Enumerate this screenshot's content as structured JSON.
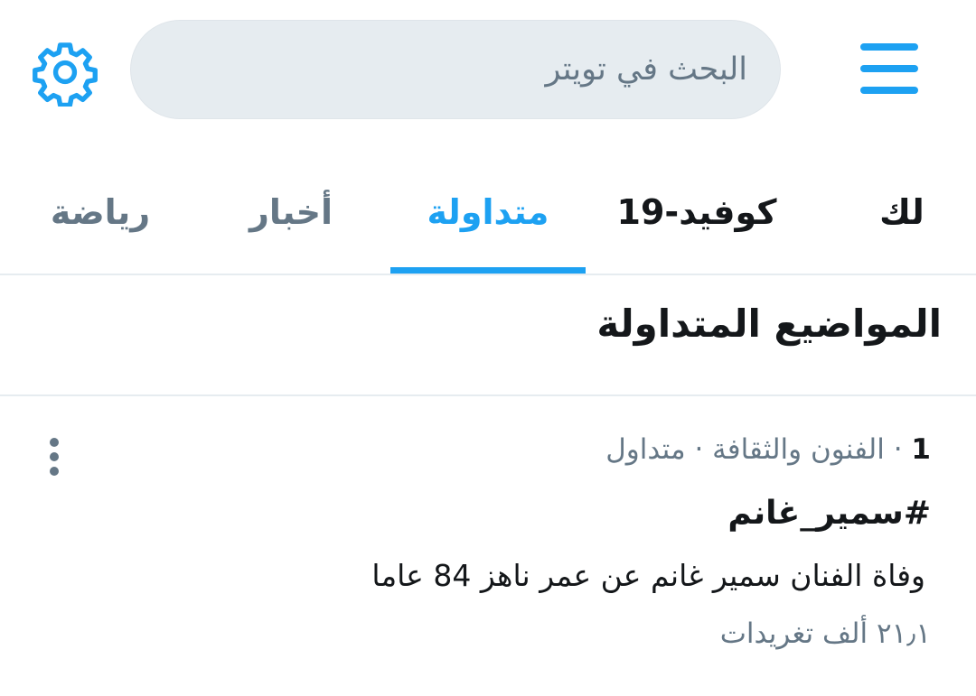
{
  "header": {
    "search_placeholder": "البحث في تويتر",
    "menu_icon": "hamburger-menu-icon",
    "settings_icon": "gear-icon"
  },
  "tabs": [
    {
      "label": "لك",
      "active": false
    },
    {
      "label": "كوفيد-19",
      "active": false
    },
    {
      "label": "متداولة",
      "active": true
    },
    {
      "label": "أخبار",
      "active": false
    },
    {
      "label": "رياضة",
      "active": false
    }
  ],
  "section": {
    "title": "المواضيع المتداولة"
  },
  "trends": [
    {
      "rank": "1",
      "separator": "·",
      "category": "الفنون والثقافة",
      "status": "متداول",
      "name": "#سمير_غانم",
      "description": "وفاة الفنان سمير غانم عن عمر ناهز 84 عاما",
      "tweet_count": "٢١٫١ ألف تغريدات"
    }
  ],
  "colors": {
    "accent": "#1da1f2",
    "primary_text": "#14171a",
    "secondary_text": "#657786",
    "search_bg": "#e6ecf0",
    "divider": "#e6ecf0"
  }
}
